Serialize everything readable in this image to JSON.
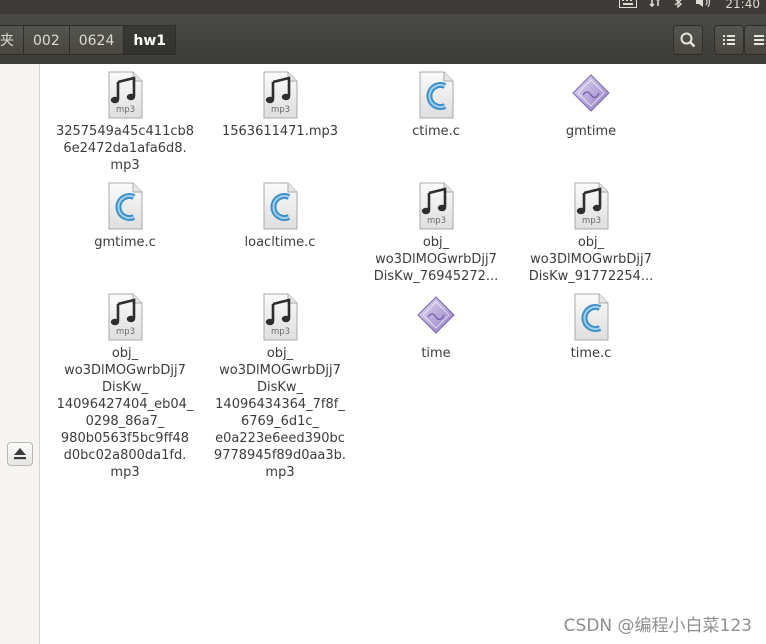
{
  "system_tray": {
    "time": "21:40"
  },
  "breadcrumbs": [
    {
      "label": "夹"
    },
    {
      "label": "002"
    },
    {
      "label": "0624"
    },
    {
      "label": "hw1"
    }
  ],
  "files": [
    {
      "name": "3257549a45c411cb8\n6e2472da1afa6d8.\nmp3",
      "icon": "mp3-audio-icon",
      "type": "mp3"
    },
    {
      "name": "1563611471.mp3",
      "icon": "mp3-audio-icon",
      "type": "mp3"
    },
    {
      "name": "ctime.c",
      "icon": "c-source-icon",
      "type": "c"
    },
    {
      "name": "gmtime",
      "icon": "executable-icon",
      "type": "exe"
    },
    {
      "name": "gmtime.c",
      "icon": "c-source-icon",
      "type": "c"
    },
    {
      "name": "loacltime.c",
      "icon": "c-source-icon",
      "type": "c"
    },
    {
      "name": "obj_\nwo3DlMOGwrbDjj7\nDisKw_76945272...",
      "icon": "mp3-audio-icon",
      "type": "mp3"
    },
    {
      "name": "obj_\nwo3DlMOGwrbDjj7\nDisKw_91772254...",
      "icon": "mp3-audio-icon",
      "type": "mp3"
    },
    {
      "name": "obj_\nwo3DlMOGwrbDjj7\nDisKw_\n14096427404_eb04_\n0298_86a7_\n980b0563f5bc9ff48\nd0bc02a800da1fd.\nmp3",
      "icon": "mp3-audio-icon",
      "type": "mp3"
    },
    {
      "name": "obj_\nwo3DlMOGwrbDjj7\nDisKw_\n14096434364_7f8f_\n6769_6d1c_\ne0a223e6eed390bc\n9778945f89d0aa3b.\nmp3",
      "icon": "mp3-audio-icon",
      "type": "mp3"
    },
    {
      "name": "time",
      "icon": "executable-icon",
      "type": "exe"
    },
    {
      "name": "time.c",
      "icon": "c-source-icon",
      "type": "c"
    }
  ],
  "watermark": "CSDN @编程小白菜123",
  "colors": {
    "toolbar": "#3c3b37",
    "icon_c": "#3d8fc8",
    "icon_exe": "#9a86c6"
  }
}
